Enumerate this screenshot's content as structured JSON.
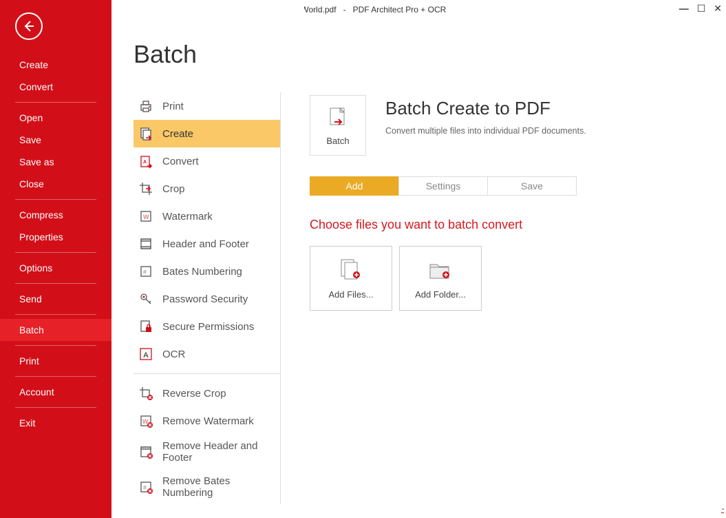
{
  "titlebar": {
    "document": "Hello World.pdf",
    "separator": "-",
    "app": "PDF Architect Pro + OCR"
  },
  "left": {
    "items": [
      {
        "label": "Create"
      },
      {
        "label": "Convert"
      }
    ],
    "items2": [
      {
        "label": "Open"
      },
      {
        "label": "Save"
      },
      {
        "label": "Save as"
      },
      {
        "label": "Close"
      }
    ],
    "items3": [
      {
        "label": "Compress"
      },
      {
        "label": "Properties"
      }
    ],
    "items4": [
      {
        "label": "Options"
      }
    ],
    "items5": [
      {
        "label": "Send"
      }
    ],
    "items6": [
      {
        "label": "Batch",
        "active": true
      }
    ],
    "items7": [
      {
        "label": "Print"
      }
    ],
    "items8": [
      {
        "label": "Account"
      }
    ],
    "items9": [
      {
        "label": "Exit"
      }
    ]
  },
  "page": {
    "title": "Batch"
  },
  "batchList": {
    "g1": [
      {
        "label": "Print",
        "icon": "print-icon"
      },
      {
        "label": "Create",
        "icon": "create-icon",
        "selected": true
      },
      {
        "label": "Convert",
        "icon": "convert-icon"
      },
      {
        "label": "Crop",
        "icon": "crop-icon"
      },
      {
        "label": "Watermark",
        "icon": "watermark-icon"
      },
      {
        "label": "Header and Footer",
        "icon": "header-footer-icon"
      },
      {
        "label": "Bates Numbering",
        "icon": "bates-icon"
      },
      {
        "label": "Password Security",
        "icon": "password-icon"
      },
      {
        "label": "Secure Permissions",
        "icon": "secure-icon"
      },
      {
        "label": "OCR",
        "icon": "ocr-icon"
      }
    ],
    "g2": [
      {
        "label": "Reverse Crop",
        "icon": "reverse-crop-icon"
      },
      {
        "label": "Remove Watermark",
        "icon": "remove-watermark-icon"
      },
      {
        "label": "Remove Header and Footer",
        "icon": "remove-header-icon"
      },
      {
        "label": "Remove Bates Numbering",
        "icon": "remove-bates-icon"
      }
    ]
  },
  "hero": {
    "boxLabel": "Batch",
    "title": "Batch Create to PDF",
    "desc": "Convert multiple files into individual PDF documents."
  },
  "steps": {
    "tabs": [
      {
        "label": "Add",
        "active": true
      },
      {
        "label": "Settings"
      },
      {
        "label": "Save"
      }
    ]
  },
  "choose": {
    "title": "Choose files you want to batch convert",
    "addFiles": "Add Files...",
    "addFolder": "Add Folder..."
  }
}
